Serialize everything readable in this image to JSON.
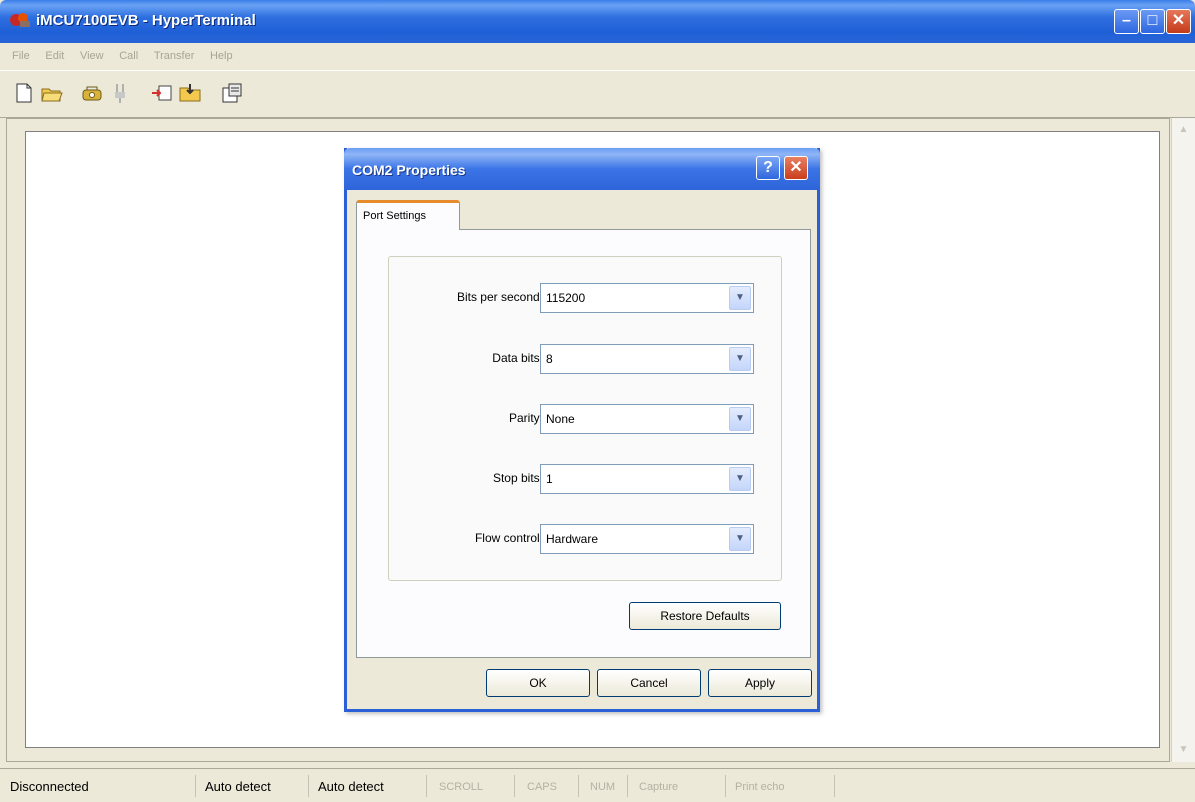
{
  "window": {
    "title": "iMCU7100EVB - HyperTerminal",
    "minimize": "–",
    "maximize": "□",
    "close": "✕"
  },
  "menu": [
    "File",
    "Edit",
    "View",
    "Call",
    "Transfer",
    "Help"
  ],
  "toolbar": {
    "icons": [
      "new-icon",
      "open-icon",
      "connect-icon",
      "disconnect-icon",
      "send-icon",
      "receive-icon",
      "properties-icon"
    ]
  },
  "status": {
    "connection": "Disconnected",
    "detect1": "Auto detect",
    "detect2": "Auto detect",
    "scroll": "SCROLL",
    "caps": "CAPS",
    "num": "NUM",
    "capture": "Capture",
    "print_echo": "Print echo"
  },
  "dialog": {
    "title": "COM2 Properties",
    "help": "?",
    "close": "✕",
    "tab": "Port Settings",
    "fields": [
      {
        "label": "Bits per second:",
        "value": "115200"
      },
      {
        "label": "Data bits:",
        "value": "8"
      },
      {
        "label": "Parity:",
        "value": "None"
      },
      {
        "label": "Stop bits:",
        "value": "1"
      },
      {
        "label": "Flow control:",
        "value": "Hardware"
      }
    ],
    "restore_defaults": "Restore Defaults",
    "ok": "OK",
    "cancel": "Cancel",
    "apply": "Apply",
    "combo_arrow": "▼"
  },
  "colors": {
    "titlebar": "#2e64d9",
    "tab_highlight": "#e68b2c",
    "close_button": "#c43a19"
  }
}
